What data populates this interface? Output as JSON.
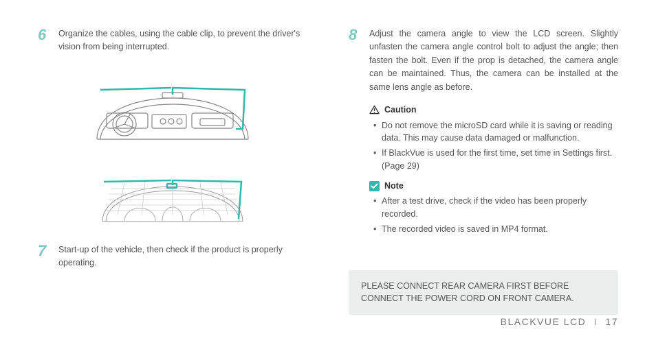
{
  "left": {
    "step6": {
      "num": "6",
      "text": "Organize the cables, using the cable clip, to prevent the driver's vision from being interrupted."
    },
    "step7": {
      "num": "7",
      "text": "Start-up of the vehicle, then check if the product is properly operating."
    }
  },
  "right": {
    "step8": {
      "num": "8",
      "text": "Adjust the camera angle to view the LCD screen. Slightly unfasten the camera angle control bolt to adjust the angle; then fasten the bolt. Even if the prop is detached, the camera angle can be maintained. Thus, the camera can be installed at the same lens angle as before."
    },
    "caution": {
      "title": "Caution",
      "items": [
        "Do not remove the microSD card while it is saving or reading data. This may cause data damaged or malfunction.",
        "If BlackVue is used for the first time, set time in Settings first. (Page 29)"
      ]
    },
    "note": {
      "title": "Note",
      "items": [
        "After a test drive, check if the video has been properly recorded.",
        "The recorded video is saved in MP4 format."
      ]
    },
    "notice": "PLEASE CONNECT REAR CAMERA FIRST BEFORE CONNECT THE POWER CORD ON FRONT CAMERA."
  },
  "footer": {
    "brand": "BLACKVUE LCD",
    "page": "17"
  }
}
